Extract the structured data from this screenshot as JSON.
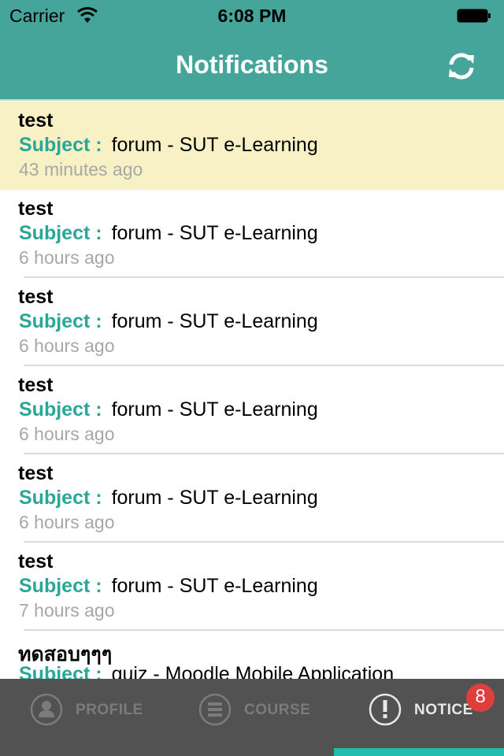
{
  "status_bar": {
    "carrier": "Carrier",
    "time": "6:08 PM"
  },
  "header": {
    "title": "Notifications",
    "refresh_icon": "refresh-icon"
  },
  "colors": {
    "header_bg": "#45a59b",
    "unread_bg": "#f9f1c6",
    "subject_label": "#29a898",
    "tabbar_bg": "#525252",
    "badge": "#de3f3b",
    "active_indicator": "#21bdb1"
  },
  "notifications": [
    {
      "title": "test",
      "subject_label": "Subject :",
      "subject": "forum - SUT e-Learning",
      "time": "43 minutes ago",
      "unread": true
    },
    {
      "title": "test",
      "subject_label": "Subject :",
      "subject": "forum - SUT e-Learning",
      "time": "6 hours ago",
      "unread": false
    },
    {
      "title": "test",
      "subject_label": "Subject :",
      "subject": "forum - SUT e-Learning",
      "time": "6 hours ago",
      "unread": false
    },
    {
      "title": "test",
      "subject_label": "Subject :",
      "subject": "forum - SUT e-Learning",
      "time": "6 hours ago",
      "unread": false
    },
    {
      "title": "test",
      "subject_label": "Subject :",
      "subject": "forum - SUT e-Learning",
      "time": "6 hours ago",
      "unread": false
    },
    {
      "title": "test",
      "subject_label": "Subject :",
      "subject": "forum - SUT e-Learning",
      "time": "7 hours ago",
      "unread": false
    },
    {
      "title": "ทดสอบๆๆๆ",
      "subject_label": "Subject :",
      "subject": "quiz - Moodle Mobile Application",
      "time": "",
      "unread": false
    }
  ],
  "tabbar": {
    "tabs": [
      {
        "label": "PROFILE",
        "icon": "profile-icon",
        "active": false
      },
      {
        "label": "COURSE",
        "icon": "course-icon",
        "active": false
      },
      {
        "label": "NOTICE",
        "icon": "notice-icon",
        "active": true
      }
    ],
    "notice_badge": "8"
  }
}
